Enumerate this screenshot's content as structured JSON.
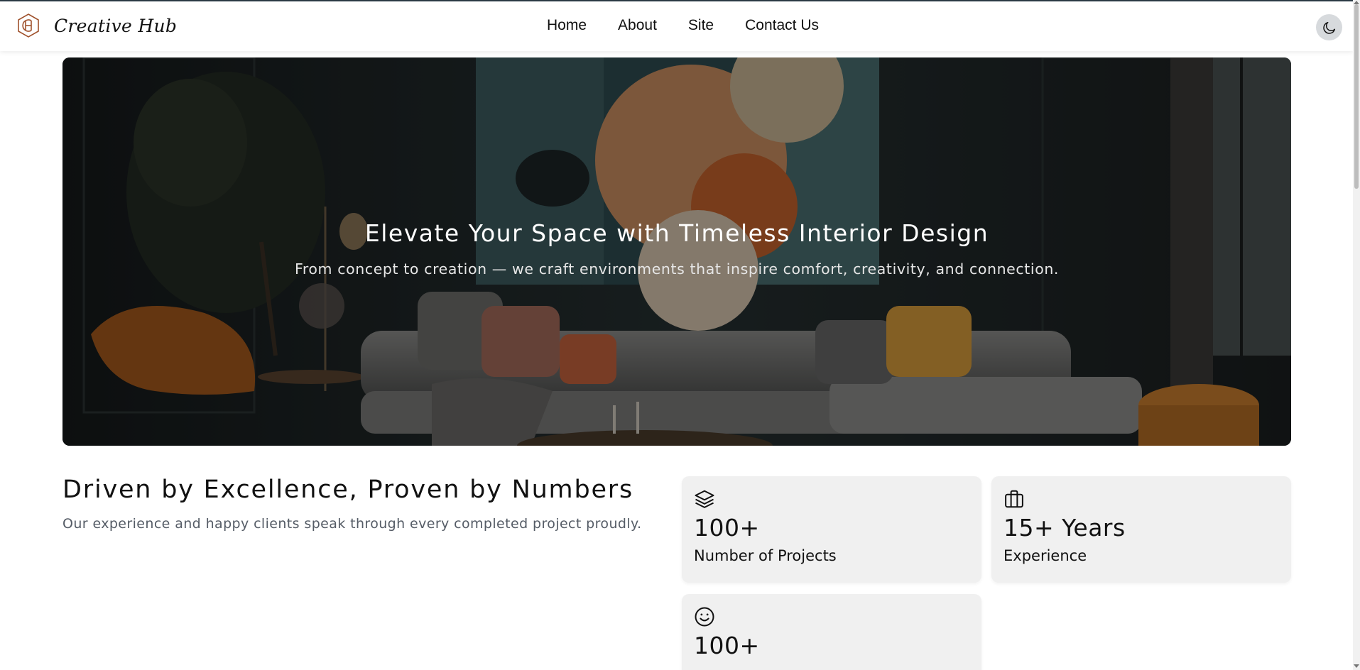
{
  "brand": {
    "name": "Creative Hub"
  },
  "nav": {
    "items": [
      {
        "label": "Home"
      },
      {
        "label": "About"
      },
      {
        "label": "Site"
      },
      {
        "label": "Contact Us"
      }
    ],
    "theme_toggle_icon": "moon-icon"
  },
  "hero": {
    "title": "Elevate Your Space with Timeless Interior Design",
    "subtitle": "From concept to creation — we craft environments that inspire comfort, creativity, and connection."
  },
  "stats": {
    "heading": "Driven by Excellence, Proven by Numbers",
    "subheading": "Our experience and happy clients speak through every completed project proudly.",
    "cards": [
      {
        "icon": "layers-icon",
        "value": "100+",
        "label": "Number of Projects"
      },
      {
        "icon": "briefcase-icon",
        "value": "15+ Years",
        "label": "Experience"
      },
      {
        "icon": "smile-icon",
        "value": "100+",
        "label": ""
      }
    ]
  },
  "colors": {
    "accent": "#a0522d",
    "card_bg": "#f0f0f0",
    "hero_overlay": "#1f2322"
  }
}
